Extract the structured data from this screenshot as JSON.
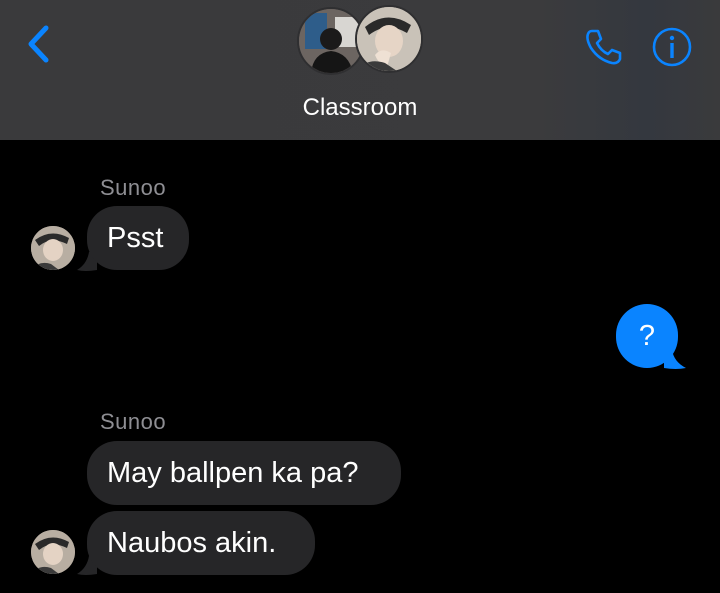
{
  "header": {
    "title": "Classroom",
    "icons": [
      "chevron-left-icon",
      "phone-icon",
      "info-icon"
    ],
    "accent_color": "#0a84ff"
  },
  "messages": [
    {
      "sender": "Sunoo",
      "text": "Psst",
      "direction": "incoming"
    },
    {
      "text": "?",
      "direction": "outgoing"
    },
    {
      "sender": "Sunoo",
      "text": "May ballpen ka pa?",
      "direction": "incoming"
    },
    {
      "text": "Naubos akin.",
      "direction": "incoming"
    }
  ]
}
